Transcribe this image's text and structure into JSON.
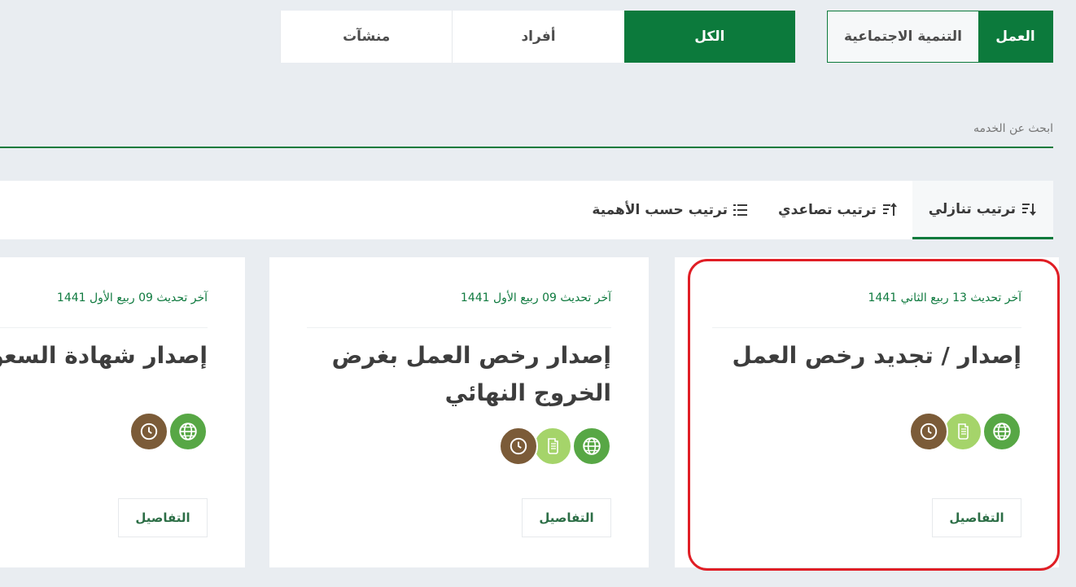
{
  "ministry_tabs": [
    {
      "label": "العمل",
      "active": true
    },
    {
      "label": "التنمية الاجتماعية",
      "active": false
    }
  ],
  "audience_tabs": [
    {
      "label": "الكل",
      "active": true
    },
    {
      "label": "أفراد",
      "active": false
    },
    {
      "label": "منشآت",
      "active": false
    }
  ],
  "search": {
    "placeholder": "ابحث عن الخدمه"
  },
  "sort_options": [
    {
      "label": "ترتيب تنازلي",
      "icon": "sort-descending-icon",
      "active": true
    },
    {
      "label": "ترتيب تصاعدي",
      "icon": "sort-ascending-icon",
      "active": false
    },
    {
      "label": "ترتيب حسب الأهمية",
      "icon": "list-icon",
      "active": false
    }
  ],
  "cards": [
    {
      "updated": "آخر تحديث 13 ربيع الثاني 1441",
      "title": "إصدار / تجديد رخص العمل",
      "icons": [
        "web-icon",
        "document-icon",
        "clock-icon"
      ],
      "details_label": "التفاصيل"
    },
    {
      "updated": "آخر تحديث 09 ربيع الأول 1441",
      "title": "إصدار رخص العمل بغرض الخروج النهائي",
      "icons": [
        "web-icon",
        "document-icon",
        "clock-icon"
      ],
      "details_label": "التفاصيل"
    },
    {
      "updated": "آخر تحديث 09 ربيع الأول 1441",
      "title": "إصدار شهادة السعودة",
      "icons": [
        "web-icon",
        "clock-icon"
      ],
      "details_label": "التفاصيل"
    }
  ],
  "colors": {
    "primary_green": "#0c7a3c",
    "web_icon_bg": "#57a745",
    "doc_icon_bg": "#a5d46a",
    "clock_icon_bg": "#7b5b38",
    "highlight": "#e01e25"
  }
}
